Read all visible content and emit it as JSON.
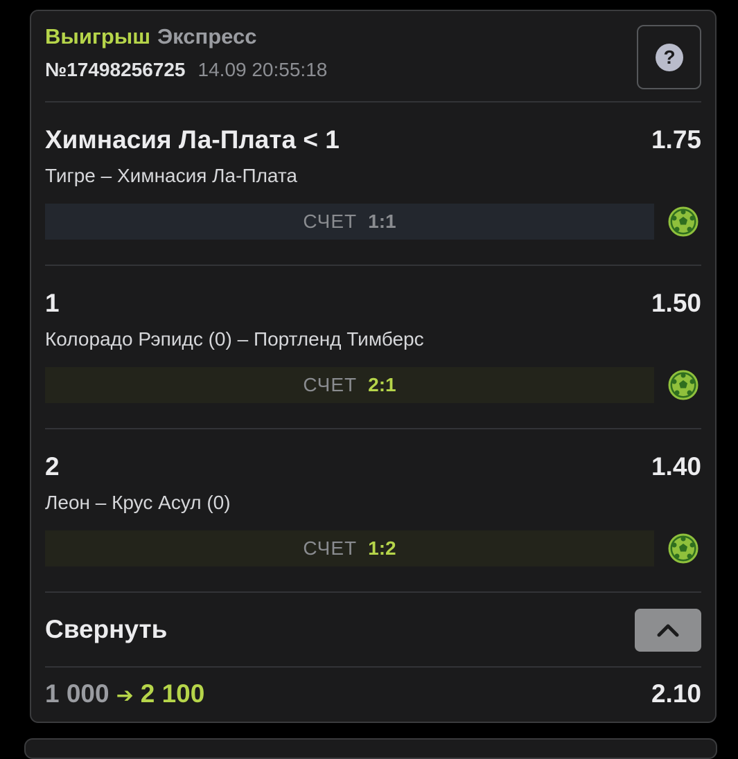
{
  "header": {
    "status": "Выигрыш",
    "bet_type": "Экспресс",
    "bet_number": "№17498256725",
    "date": "14.09 20:55:18",
    "help_glyph": "?"
  },
  "events": [
    {
      "outcome": "Химнасия Ла-Плата < 1",
      "odds": "1.75",
      "match": "Тигре – Химнасия Ла-Плата",
      "score_label": "СЧЕТ",
      "score": "1:1",
      "score_state": "pending",
      "icon": "football-icon"
    },
    {
      "outcome": "1",
      "odds": "1.50",
      "match": "Колорадо Рэпидс (0) – Портленд Тимберс",
      "score_label": "СЧЕТ",
      "score": "2:1",
      "score_state": "won",
      "icon": "football-icon"
    },
    {
      "outcome": "2",
      "odds": "1.40",
      "match": "Леон – Крус Асул (0)",
      "score_label": "СЧЕТ",
      "score": "1:2",
      "score_state": "won",
      "icon": "football-icon"
    }
  ],
  "collapse": {
    "label": "Свернуть",
    "icon": "chevron-up-icon"
  },
  "footer": {
    "stake": "1 000",
    "arrow": "➔",
    "payout": "2 100",
    "total_odds": "2.10"
  },
  "colors": {
    "accent": "#b6d54a",
    "card_bg": "#1b1b1c",
    "page_bg": "#000000"
  }
}
